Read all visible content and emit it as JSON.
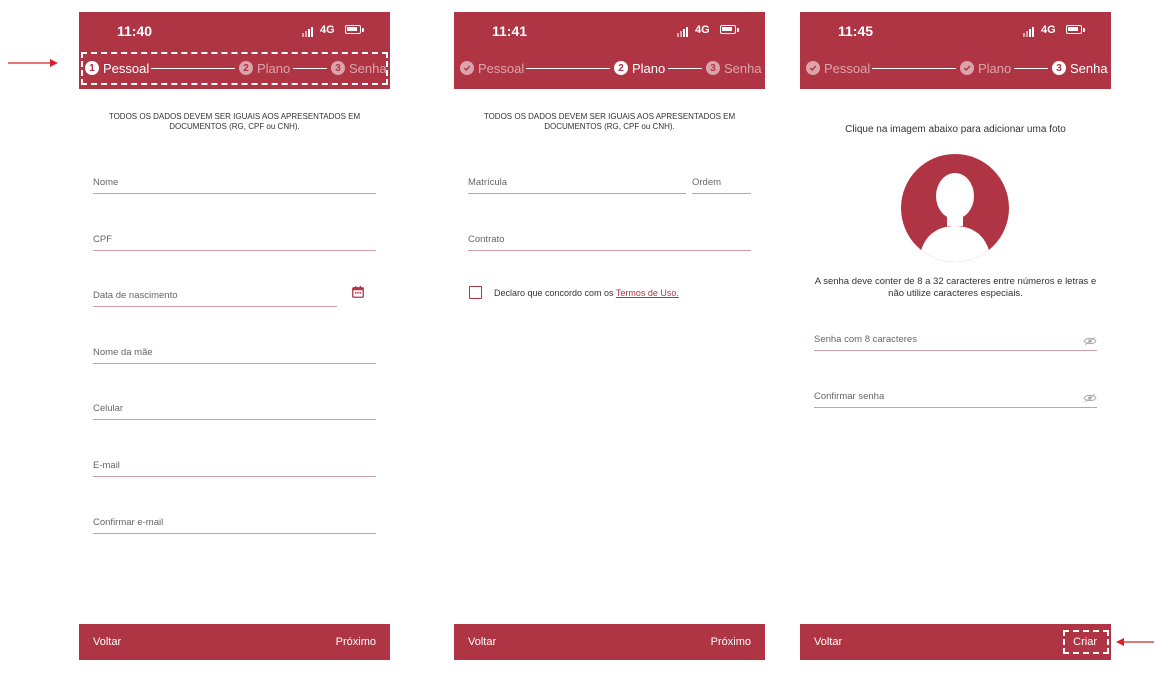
{
  "brand_color": "#b03544",
  "screens": [
    {
      "time": "11:40",
      "network": "4G",
      "steps": [
        {
          "label": "Pessoal",
          "number": "1",
          "state": "active"
        },
        {
          "label": "Plano",
          "number": "2",
          "state": "pending"
        },
        {
          "label": "Senha",
          "number": "3",
          "state": "pending"
        }
      ],
      "notice": "TODOS OS DADOS DEVEM SER IGUAIS AOS APRESENTADOS EM DOCUMENTOS (RG, CPF ou CNH).",
      "fields": {
        "nome": "Nome",
        "cpf": "CPF",
        "data_nascimento": "Data de nascimento",
        "nome_mae": "Nome da mãe",
        "celular": "Celular",
        "email": "E-mail",
        "confirmar_email": "Confirmar e-mail"
      },
      "footer": {
        "back": "Voltar",
        "next": "Próximo"
      }
    },
    {
      "time": "11:41",
      "network": "4G",
      "steps": [
        {
          "label": "Pessoal",
          "state": "done"
        },
        {
          "label": "Plano",
          "number": "2",
          "state": "active"
        },
        {
          "label": "Senha",
          "number": "3",
          "state": "pending"
        }
      ],
      "notice": "TODOS OS DADOS DEVEM SER IGUAIS AOS APRESENTADOS EM DOCUMENTOS (RG, CPF ou CNH).",
      "fields": {
        "matricula": "Matrícula",
        "ordem": "Ordem",
        "contrato": "Contrato"
      },
      "terms": {
        "text": "Declaro que concordo com os",
        "link": "Termos de Uso."
      },
      "footer": {
        "back": "Voltar",
        "next": "Próximo"
      }
    },
    {
      "time": "11:45",
      "network": "4G",
      "steps": [
        {
          "label": "Pessoal",
          "state": "done"
        },
        {
          "label": "Plano",
          "state": "done"
        },
        {
          "label": "Senha",
          "number": "3",
          "state": "active"
        }
      ],
      "photo_hint": "Clique na imagem abaixo para adicionar uma foto",
      "password_hint": "A senha deve conter de 8 a 32 caracteres entre números e letras e não utilize caracteres especiais.",
      "fields": {
        "senha": "Senha com 8 caracteres",
        "confirmar_senha": "Confirmar senha"
      },
      "footer": {
        "back": "Voltar",
        "next": "Criar"
      }
    }
  ]
}
